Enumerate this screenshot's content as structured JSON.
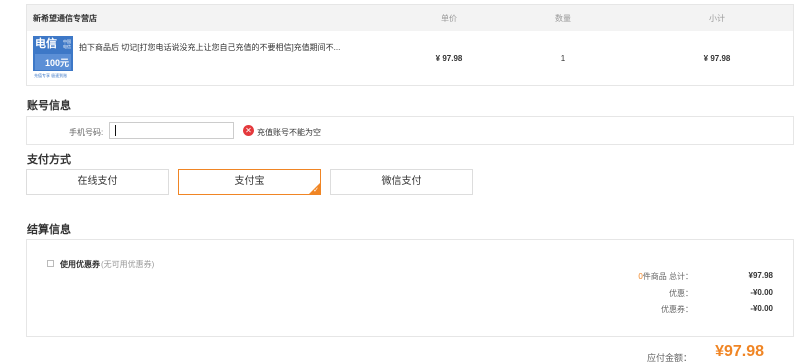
{
  "order": {
    "shop_name": "新希望通信专营店",
    "col_price": "单价",
    "col_qty": "数量",
    "col_subtotal": "小计",
    "item": {
      "thumb_main": "电信",
      "thumb_side": "中国电信",
      "thumb_amount": "100元",
      "thumb_footer": "充值专享 极速到账",
      "title": "拍下商品后 切记[打您电话说没充上让您自己充值的不要相信]充值期间不...",
      "price": "¥ 97.98",
      "qty": "1",
      "subtotal": "¥ 97.98"
    }
  },
  "account": {
    "section_title": "账号信息",
    "phone_label": "手机号码:",
    "phone_value": "",
    "error_icon": "error-circle-icon",
    "error_text": "充值账号不能为空"
  },
  "payment": {
    "section_title": "支付方式",
    "options": [
      {
        "label": "在线支付",
        "selected": false
      },
      {
        "label": "支付宝",
        "selected": true
      },
      {
        "label": "微信支付",
        "selected": false
      }
    ],
    "accent_color": "#f08524"
  },
  "settlement": {
    "section_title": "结算信息",
    "coupon_label": "使用优惠券",
    "coupon_note": "(无可用优惠券)",
    "item_count": "0",
    "item_count_suffix": "件商品  总计：",
    "goods_total": "¥97.98",
    "discount_label": "优惠：",
    "discount_value": "-¥0.00",
    "coupon_discount_label": "优惠券：",
    "coupon_discount_value": "-¥0.00",
    "payable_label": "应付金额：",
    "payable_value": "¥97.98"
  }
}
